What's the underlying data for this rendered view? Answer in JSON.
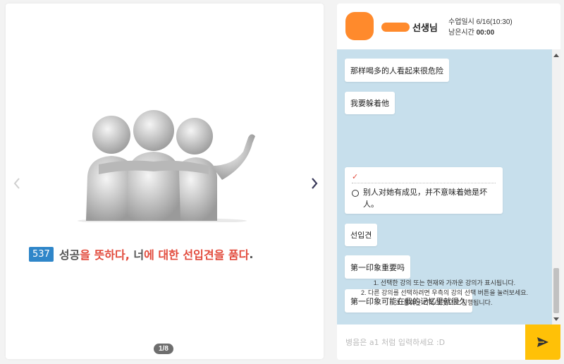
{
  "slide": {
    "number": "537",
    "sentence": [
      {
        "text": "성공",
        "color": "gray"
      },
      {
        "text": "을 뜻하다, ",
        "color": "red"
      },
      {
        "text": "너",
        "color": "gray"
      },
      {
        "text": "에 대한 선입견을 품다",
        "color": "red"
      },
      {
        "text": ".",
        "color": "gray"
      }
    ],
    "page_indicator": "1/8",
    "image_icon": "three-friends-figure"
  },
  "header": {
    "teacher_label": "선생님",
    "class_time": "수업일시 6/16(10:30)",
    "remaining_label": "남은시간",
    "remaining_time": "00:00",
    "avatar_color": "#ff8a2c"
  },
  "messages": [
    {
      "type": "text",
      "text": "那样喝多的人看起来很危险"
    },
    {
      "type": "text",
      "text": "我要躲着他"
    },
    {
      "type": "quiz",
      "text": "别人对她有成见，并不意味着她是坏人。"
    },
    {
      "type": "text",
      "text": "선입견"
    },
    {
      "type": "text",
      "text": "第一印象重要吗"
    },
    {
      "type": "text",
      "text": "第一印象可能在我的记忆里就很久"
    }
  ],
  "notice": [
    "1. 선택한 강의 또는 현재와 가까운 강의가 표시됩니다.",
    "2. 다른 강의를 선택하려면 우측의 강의 선택 버튼을 눌러보세요.",
    "3. 통화는 카톡/위챗으로 진행됩니다."
  ],
  "input": {
    "placeholder": "병음은 a1 처럼 입력하세요 :D"
  },
  "colors": {
    "accent": "#ffc107",
    "badge": "#2f86c9",
    "highlight": "#e24a3b",
    "chat_bg": "#c7dfec"
  }
}
